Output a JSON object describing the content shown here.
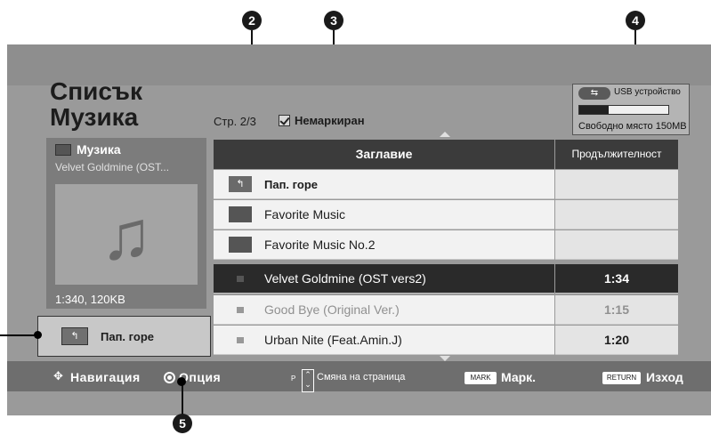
{
  "callouts": [
    "2",
    "3",
    "4",
    "5"
  ],
  "header": {
    "title_line1": "Списък",
    "title_line2": "Музика",
    "page_info": "Стр. 2/3",
    "unmarked": "Немаркиран"
  },
  "usb": {
    "label": "USB устройство",
    "free_space": "Свободно място 150MB",
    "used_fraction": 0.33
  },
  "left_panel": {
    "title": "Музика",
    "subtitle": "Velvet Goldmine (OST...",
    "info": "1:340, 120KB",
    "up_button": "Пап. горе"
  },
  "table": {
    "col_title": "Заглавие",
    "col_duration": "Продължителност",
    "rows": [
      {
        "label": "Пап. горе",
        "duration": ""
      },
      {
        "label": "Favorite Music",
        "duration": ""
      },
      {
        "label": "Favorite Music No.2",
        "duration": ""
      },
      {
        "label": "Velvet Goldmine (OST vers2)",
        "duration": "1:34"
      },
      {
        "label": "Good Bye (Original Ver.)",
        "duration": "1:15"
      },
      {
        "label": "Urban Nite (Feat.Amin.J)",
        "duration": "1:20"
      }
    ]
  },
  "footer": {
    "navigation": "Навигация",
    "option": "Опция",
    "p_key": "P",
    "page_change": "Смяна на страница",
    "mark_key": "MARK",
    "mark_label": "Марк.",
    "return_key": "RETURN",
    "exit_label": "Изход"
  }
}
